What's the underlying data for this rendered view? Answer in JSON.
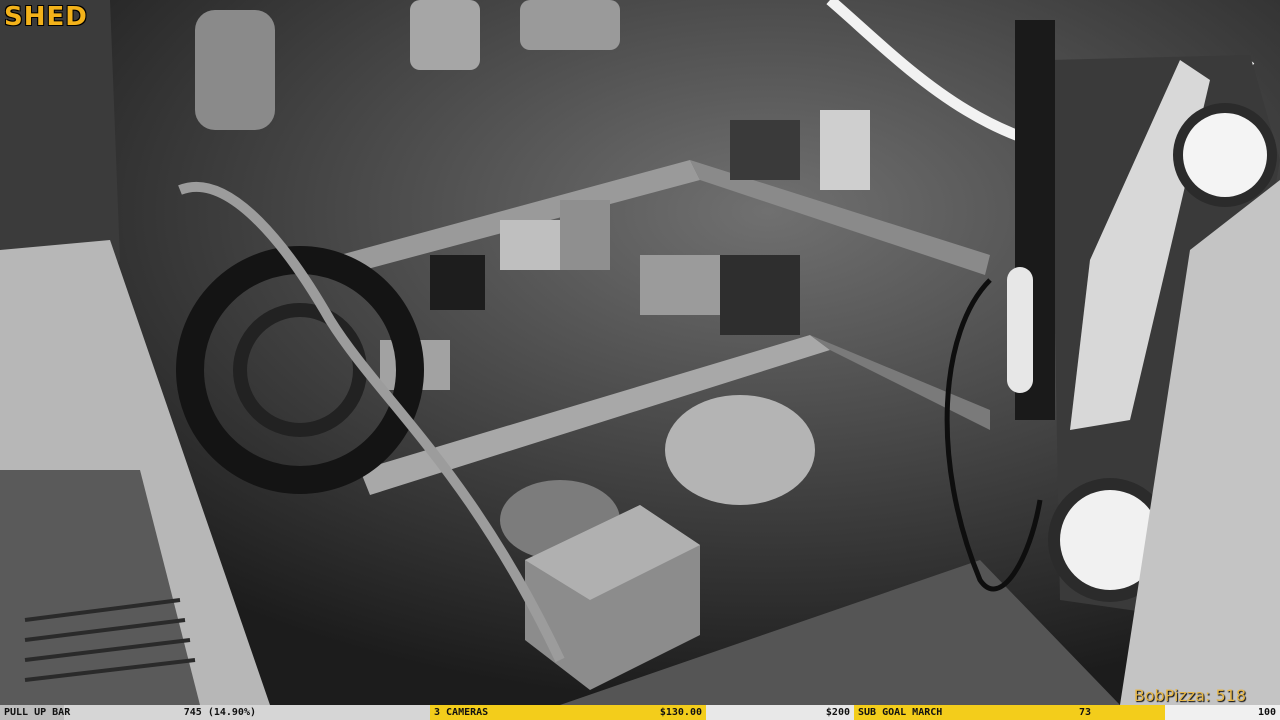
{
  "camera": {
    "title": "SHED"
  },
  "chat": {
    "username": "BobPizza",
    "value": "518",
    "display": "BobPizza: 518"
  },
  "ticker": {
    "pull_up": {
      "label": "PULL UP BAR",
      "value": "745 (14.90%)",
      "progress": 0.149
    },
    "cameras": {
      "label": "3 CAMERAS",
      "value": "$130.00"
    },
    "goal_amount": "$200",
    "sub_goal": {
      "label": "SUB GOAL MARCH",
      "value": "73",
      "target": "100"
    }
  },
  "colors": {
    "title": "#f3b21a",
    "yellow_band": "#f3cd1b",
    "chat": "#e7b84a"
  }
}
